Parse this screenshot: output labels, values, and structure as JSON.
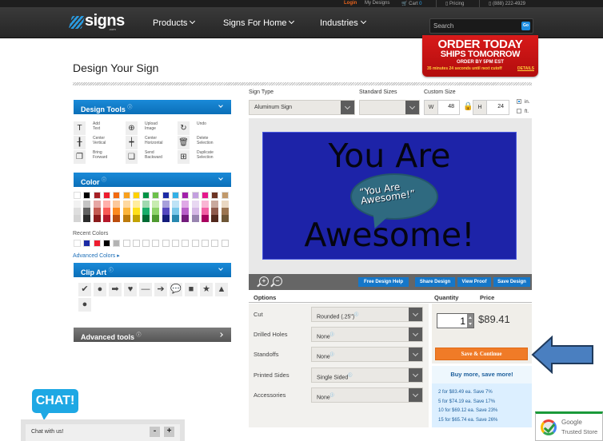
{
  "topbar": {
    "login": "Login",
    "my_designs": "My Designs",
    "cart_label": "Cart",
    "cart_count": "0",
    "pricing": "Pricing",
    "phone": "(888) 222-4929"
  },
  "navbar": {
    "logo": "signs",
    "logo_suffix": ".com",
    "items": [
      {
        "label": "Products"
      },
      {
        "label": "Signs For Home"
      },
      {
        "label": "Industries"
      }
    ],
    "search_placeholder": "Search",
    "search_go": "Go"
  },
  "promo": {
    "line1": "ORDER TODAY",
    "line2": "SHIPS TOMORROW",
    "line3": "ORDER BY 5PM EST",
    "countdown": "35 minutes 24 seconds until next cutoff",
    "details": "DETAILS"
  },
  "page": {
    "title": "Design Your Sign"
  },
  "design_tools": {
    "title": "Design Tools",
    "tools": [
      {
        "icon": "T",
        "label": "Add\nText"
      },
      {
        "icon": "⊕",
        "label": "Upload\nImage"
      },
      {
        "icon": "↻",
        "label": "Undo"
      },
      {
        "icon": "╂",
        "label": "Center\nVertical"
      },
      {
        "icon": "┿",
        "label": "Center\nHorizontal"
      },
      {
        "icon": "🗑",
        "label": "Delete\nSelection"
      },
      {
        "icon": "❐",
        "label": "Bring\nForward"
      },
      {
        "icon": "❏",
        "label": "Send\nBackward"
      },
      {
        "icon": "⊞",
        "label": "Duplicate\nSelection"
      }
    ]
  },
  "color": {
    "title": "Color",
    "palette": [
      [
        "#ffffff",
        "#000000",
        "#a61f24",
        "#ee1c2e",
        "#f26b0f",
        "#f9a01b",
        "#ffd200",
        "#009345",
        "#6cc04a",
        "#1b2aa5",
        "#33b0e6",
        "#a21faa",
        "#c39fdf",
        "#e6178c",
        "#6d3524",
        "#c1996b"
      ],
      [
        "#f2f2f2",
        "#c4c4c4",
        "#e6a7a5",
        "#ffb1ab",
        "#fcc89b",
        "#fed9a1",
        "#ffed9e",
        "#a0d9b0",
        "#c8ecb0",
        "#a79fdb",
        "#bde3f6",
        "#dfa8e6",
        "#e8d8f2",
        "#f9b5d4",
        "#c9a99e",
        "#ead8c2"
      ],
      [
        "#dedede",
        "#636363",
        "#c45b52",
        "#f95b56",
        "#fd8a1e",
        "#fcb53a",
        "#ffe01b",
        "#1aae6b",
        "#8fd36a",
        "#5548c0",
        "#79c8ea",
        "#b85fc8",
        "#d5b8e6",
        "#f25fa4",
        "#8e5a4c",
        "#9b7551"
      ],
      [
        "#d4d4d4",
        "#2b2b2b",
        "#8a1b1b",
        "#b5192a",
        "#bb4d0d",
        "#bd7b0c",
        "#c2a203",
        "#006b33",
        "#4f9a30",
        "#141c7c",
        "#2788b0",
        "#731c7c",
        "#9884b0",
        "#a8005e",
        "#52281c",
        "#6e5636"
      ]
    ],
    "recent_label": "Recent Colors",
    "recent": [
      "#ffffff",
      "#1b2aa5",
      "#ee1c2e",
      "#000000",
      "#b3b3b3",
      "",
      "",
      "",
      "",
      "",
      "",
      "",
      "",
      "",
      "",
      ""
    ],
    "advanced_link": "Advanced Colors ▸"
  },
  "clip_art": {
    "title": "Clip Art",
    "items": [
      {
        "name": "checkmark",
        "glyph": "✔"
      },
      {
        "name": "circle",
        "glyph": "●"
      },
      {
        "name": "block-arrow",
        "glyph": "➡"
      },
      {
        "name": "heart",
        "glyph": "♥"
      },
      {
        "name": "line",
        "glyph": "—"
      },
      {
        "name": "arrow",
        "glyph": "➔"
      },
      {
        "name": "speech-bubble",
        "glyph": "💬"
      },
      {
        "name": "square",
        "glyph": "■"
      },
      {
        "name": "star",
        "glyph": "★"
      },
      {
        "name": "triangle",
        "glyph": "▲"
      },
      {
        "name": "circle-2",
        "glyph": "●"
      }
    ]
  },
  "advanced_tools": {
    "title": "Advanced tools"
  },
  "config": {
    "sign_type_label": "Sign Type",
    "sign_type_value": "Aluminum Sign",
    "standard_sizes_label": "Standard Sizes",
    "standard_sizes_value": "",
    "custom_size_label": "Custom Size",
    "width_key": "W",
    "width_value": "48",
    "height_key": "H",
    "height_value": "24",
    "unit_in": "in.",
    "unit_ft": "ft.",
    "unit_selected": "in."
  },
  "sign": {
    "background": "#1d23a8",
    "line1": "You Are",
    "bubble_text": "“You Are Awesome!”",
    "line2": "Awesome!"
  },
  "canvas_toolbar": {
    "free_help": "Free Design Help",
    "share": "Share Design",
    "proof": "View Proof",
    "save": "Save Design"
  },
  "options": {
    "header": "Options",
    "quantity_header": "Quantity",
    "price_header": "Price",
    "rows": [
      {
        "label": "Cut",
        "value": "Rounded (.25\")"
      },
      {
        "label": "Drilled Holes",
        "value": "None"
      },
      {
        "label": "Standoffs",
        "value": "None"
      },
      {
        "label": "Printed Sides",
        "value": "Single Sided"
      },
      {
        "label": "Accessories",
        "value": "None"
      }
    ]
  },
  "order": {
    "quantity": "1",
    "price": "$89.41",
    "save_continue": "Save & Continue",
    "buy_more": "Buy more, save more!",
    "tiers": [
      "2 for $83.49 ea. Save 7%",
      "5 for $74.19 ea. Save 17%",
      "10 for $69.12 ea. Save 23%",
      "15 for $65.74 ea. Save 26%"
    ]
  },
  "trusted_store": {
    "line1": "Google",
    "line2": "Trusted Store"
  },
  "chat": {
    "badge": "CHAT!",
    "label": "Chat with us!",
    "minimize": "-",
    "expand": "+"
  }
}
